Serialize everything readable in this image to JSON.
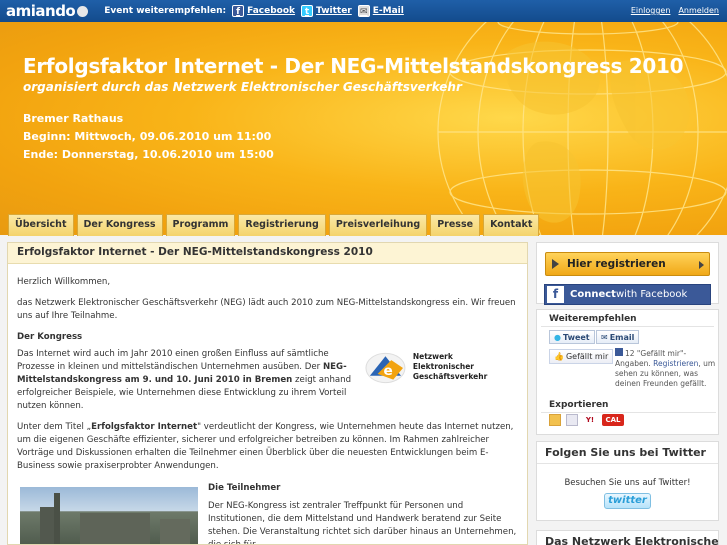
{
  "topbar": {
    "logo": "amiando",
    "share_label": "Event weiterempfehlen:",
    "facebook": "Facebook",
    "twitter": "Twitter",
    "email": "E-Mail",
    "login": "Einloggen",
    "register": "Anmelden"
  },
  "hero": {
    "title": "Erfolgsfaktor Internet - Der NEG-Mittelstandskongress 2010",
    "subtitle": "organisiert durch das Netzwerk Elektronischer Geschäftsverkehr",
    "location": "Bremer Rathaus",
    "begin": "Beginn: Mittwoch, 09.06.2010 um 11:00",
    "end": "Ende: Donnerstag, 10.06.2010 um 15:00"
  },
  "nav": [
    "Übersicht",
    "Der Kongress",
    "Programm",
    "Registrierung",
    "Preisverleihung",
    "Presse",
    "Kontakt"
  ],
  "main": {
    "title": "Erfolgsfaktor Internet - Der NEG-Mittelstandskongress 2010",
    "greeting": "Herzlich Willkommen,",
    "intro": "das Netzwerk Elektronischer Geschäftsverkehr (NEG) lädt auch 2010 zum NEG-Mittelstandskongress ein. Wir freuen uns auf Ihre Teilnahme.",
    "kongress_heading": "Der Kongress",
    "kongress_1": "Das Internet wird auch im Jahr 2010 einen großen Einfluss auf sämtliche Prozesse in kleinen und mittelständischen Unternehmen ausüben. Der",
    "kongress_bold": "NEG-Mittelstandskongress am 9. und 10. Juni 2010 in Bremen",
    "kongress_2": "zeigt anhand erfolgreicher Beispiele, wie Unternehmen diese Entwicklung zu ihrem Vorteil nutzen können.",
    "titel_1": "Unter dem Titel „",
    "titel_bold": "Erfolgsfaktor Internet",
    "titel_2": "\" verdeutlicht der Kongress, wie Unternehmen heute das Internet nutzen, um die eigenen Geschäfte effizienter, sicherer und erfolgreicher betreiben zu können. Im Rahmen zahlreicher Vorträge und Diskussionen erhalten die Teilnehmer einen Überblick über die neuesten Entwicklungen beim E-Business sowie praxiserprobter Anwendungen.",
    "neg_logo_line1": "Netzwerk Elektronischer",
    "neg_logo_line2": "Geschäftsverkehr",
    "teil_heading": "Die Teilnehmer",
    "teil_text": "Der NEG-Kongress ist zentraler Treffpunkt für Personen und Institutionen, die dem Mittelstand und Handwerk beratend zur Seite stehen. Die Veranstaltung richtet sich darüber hinaus an Unternehmen, die sich für"
  },
  "sidebar": {
    "register_btn": "Hier registrieren",
    "fb_connect_1": "Connect",
    "fb_connect_2": " with Facebook",
    "weiter_heading": "Weiterempfehlen",
    "tweet": "Tweet",
    "email": "Email",
    "like": "Gefällt mir",
    "like_count": "12 \"Gefällt mir\"-Angaben.",
    "like_reg": "Registrieren",
    "like_rest": ", um sehen zu können, was deinen Freunden gefällt.",
    "export_heading": "Exportieren",
    "export_cal": "CAL",
    "twitter_heading": "Folgen Sie uns bei Twitter",
    "twitter_text": "Besuchen Sie uns auf Twitter!",
    "twitter_btn": "twitter",
    "neg_heading": "Das Netzwerk Elektronischer"
  },
  "colors": {
    "topbar": "#1f5fa8",
    "banner": "#f9b418",
    "facebook": "#3b5998"
  }
}
